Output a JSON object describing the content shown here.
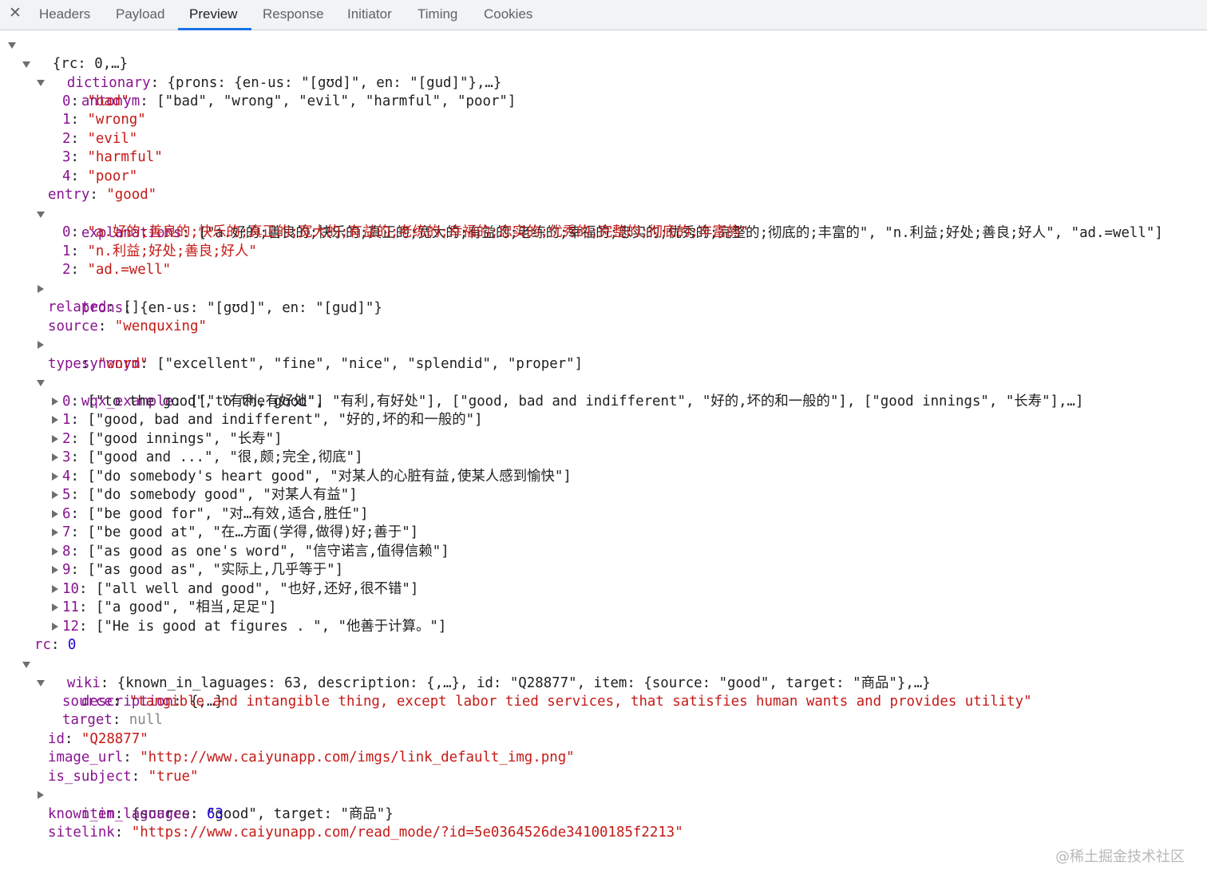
{
  "tabs": {
    "close": "✕",
    "headers": "Headers",
    "payload": "Payload",
    "preview": "Preview",
    "response": "Response",
    "initiator": "Initiator",
    "timing": "Timing",
    "cookies": "Cookies"
  },
  "tree": {
    "root": "{rc: 0,…}",
    "dictionary": {
      "key": "dictionary",
      "summary": "{prons: {en-us: \"[gʊd]\", en: \"[gud]\"},…}",
      "antonym": {
        "key": "antonym",
        "summary": "[\"bad\", \"wrong\", \"evil\", \"harmful\", \"poor\"]",
        "items": [
          {
            "i": "0",
            "v": "\"bad\""
          },
          {
            "i": "1",
            "v": "\"wrong\""
          },
          {
            "i": "2",
            "v": "\"evil\""
          },
          {
            "i": "3",
            "v": "\"harmful\""
          },
          {
            "i": "4",
            "v": "\"poor\""
          }
        ]
      },
      "entry": {
        "key": "entry",
        "v": "\"good\""
      },
      "explanations": {
        "key": "explanations",
        "summary": "[\"a.好的;善良的;快乐的;真正的;宽大的;有益的;老练的;幸福的;忠实的;优秀的;完整的;彻底的;丰富的\", \"n.利益;好处;善良;好人\", \"ad.=well\"]",
        "items": [
          {
            "i": "0",
            "v": "\"a.好的;善良的;快乐的;真正的;宽大的;有益的;老练的;幸福的;忠实的;优秀的;完整的;彻底的;丰富的\""
          },
          {
            "i": "1",
            "v": "\"n.利益;好处;善良;好人\""
          },
          {
            "i": "2",
            "v": "\"ad.=well\""
          }
        ]
      },
      "prons": {
        "key": "prons",
        "summary": "{en-us: \"[gʊd]\", en: \"[gud]\"}"
      },
      "related": {
        "key": "related",
        "summary": "[]"
      },
      "source": {
        "key": "source",
        "v": "\"wenquxing\""
      },
      "synonym": {
        "key": "synonym",
        "summary": "[\"excellent\", \"fine\", \"nice\", \"splendid\", \"proper\"]"
      },
      "type": {
        "key": "type",
        "v": "\"word\""
      },
      "wqx_example": {
        "key": "wqx_example",
        "summary": "[[\"to the good\", \"有利,有好处\"], [\"good, bad and indifferent\", \"好的,坏的和一般的\"], [\"good innings\", \"长寿\"],…]",
        "items": [
          {
            "i": "0",
            "v": "[\"to the good\", \"有利,有好处\"]"
          },
          {
            "i": "1",
            "v": "[\"good, bad and indifferent\", \"好的,坏的和一般的\"]"
          },
          {
            "i": "2",
            "v": "[\"good innings\", \"长寿\"]"
          },
          {
            "i": "3",
            "v": "[\"good and ...\", \"很,颇;完全,彻底\"]"
          },
          {
            "i": "4",
            "v": "[\"do somebody's heart good\", \"对某人的心脏有益,使某人感到愉快\"]"
          },
          {
            "i": "5",
            "v": "[\"do somebody good\", \"对某人有益\"]"
          },
          {
            "i": "6",
            "v": "[\"be good for\", \"对…有效,适合,胜任\"]"
          },
          {
            "i": "7",
            "v": "[\"be good at\", \"在…方面(学得,做得)好;善于\"]"
          },
          {
            "i": "8",
            "v": "[\"as good as one's word\", \"信守诺言,值得信赖\"]"
          },
          {
            "i": "9",
            "v": "[\"as good as\", \"实际上,几乎等于\"]"
          },
          {
            "i": "10",
            "v": "[\"all well and good\", \"也好,还好,很不错\"]"
          },
          {
            "i": "11",
            "v": "[\"a good\", \"相当,足足\"]"
          },
          {
            "i": "12",
            "v": "[\"He is good at figures . \", \"他善于计算。\"]"
          }
        ]
      }
    },
    "rc": {
      "key": "rc",
      "v": "0"
    },
    "wiki": {
      "key": "wiki",
      "summary": "{known_in_laguages: 63, description: {,…}, id: \"Q28877\", item: {source: \"good\", target: \"商品\"},…}",
      "description": {
        "key": "description",
        "summary": "{,…}",
        "source": {
          "key": "source",
          "v": "\"tangible and intangible thing, except labor tied services, that satisfies human wants and provides utility\""
        },
        "target": {
          "key": "target",
          "v": "null"
        }
      },
      "id": {
        "key": "id",
        "v": "\"Q28877\""
      },
      "image_url": {
        "key": "image_url",
        "v": "\"http://www.caiyunapp.com/imgs/link_default_img.png\""
      },
      "is_subject": {
        "key": "is_subject",
        "v": "\"true\""
      },
      "item": {
        "key": "item",
        "summary": "{source: \"good\", target: \"商品\"}"
      },
      "known_in_laguages": {
        "key": "known_in_laguages",
        "v": "63"
      },
      "sitelink": {
        "key": "sitelink",
        "v": "\"https://www.caiyunapp.com/read_mode/?id=5e0364526de34100185f2213\""
      }
    }
  },
  "watermark": "@稀土掘金技术社区",
  "colors": {
    "key": "#881391",
    "string": "#c41a16",
    "number": "#1c00cf",
    "null": "#80868b",
    "tab_accent": "#1a73e8"
  }
}
